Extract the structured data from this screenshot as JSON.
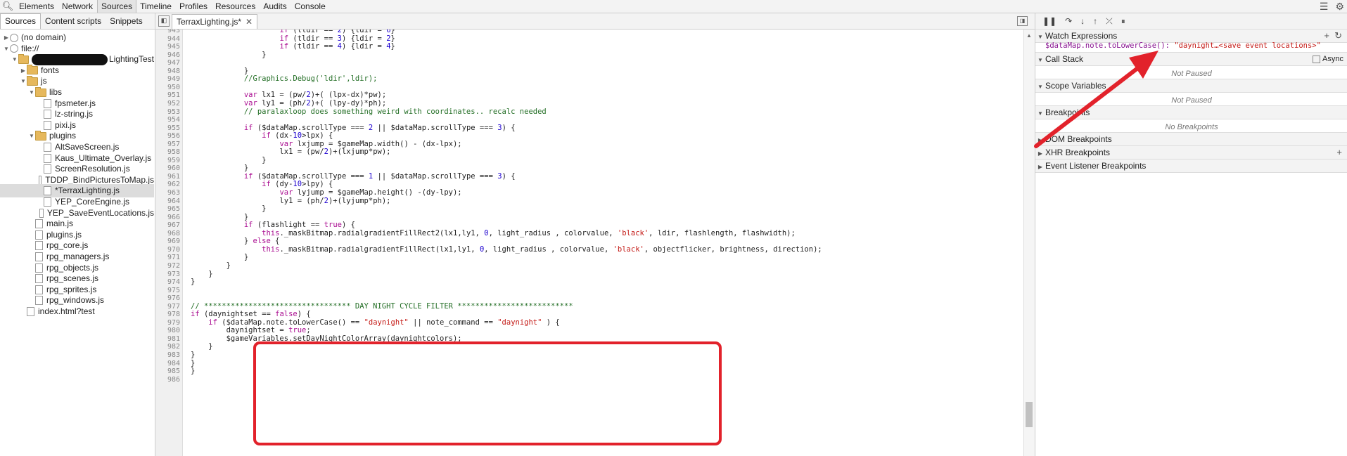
{
  "toolbar": {
    "tabs": [
      "Elements",
      "Network",
      "Sources",
      "Timeline",
      "Profiles",
      "Resources",
      "Audits",
      "Console"
    ],
    "active_tab": "Sources"
  },
  "sidebar": {
    "tabs": [
      "Sources",
      "Content scripts",
      "Snippets"
    ],
    "tree": [
      {
        "label": "(no domain)",
        "type": "globe",
        "depth": 0,
        "arrow": "▶"
      },
      {
        "label": "file://",
        "type": "globe",
        "depth": 0,
        "arrow": "▼"
      },
      {
        "label": "LightingTest",
        "type": "folder",
        "depth": 1,
        "arrow": "▼",
        "redacted": true
      },
      {
        "label": "fonts",
        "type": "folder",
        "depth": 2,
        "arrow": "▶"
      },
      {
        "label": "js",
        "type": "folder",
        "depth": 2,
        "arrow": "▼"
      },
      {
        "label": "libs",
        "type": "folder",
        "depth": 3,
        "arrow": "▼"
      },
      {
        "label": "fpsmeter.js",
        "type": "file",
        "depth": 4
      },
      {
        "label": "lz-string.js",
        "type": "file",
        "depth": 4
      },
      {
        "label": "pixi.js",
        "type": "file",
        "depth": 4
      },
      {
        "label": "plugins",
        "type": "folder",
        "depth": 3,
        "arrow": "▼"
      },
      {
        "label": "AltSaveScreen.js",
        "type": "file",
        "depth": 4
      },
      {
        "label": "Kaus_Ultimate_Overlay.js",
        "type": "file",
        "depth": 4
      },
      {
        "label": "ScreenResolution.js",
        "type": "file",
        "depth": 4
      },
      {
        "label": "TDDP_BindPicturesToMap.js",
        "type": "file",
        "depth": 4
      },
      {
        "label": "*TerraxLighting.js",
        "type": "file",
        "depth": 4,
        "selected": true
      },
      {
        "label": "YEP_CoreEngine.js",
        "type": "file",
        "depth": 4
      },
      {
        "label": "YEP_SaveEventLocations.js",
        "type": "file",
        "depth": 4
      },
      {
        "label": "main.js",
        "type": "file",
        "depth": 3
      },
      {
        "label": "plugins.js",
        "type": "file",
        "depth": 3
      },
      {
        "label": "rpg_core.js",
        "type": "file",
        "depth": 3
      },
      {
        "label": "rpg_managers.js",
        "type": "file",
        "depth": 3
      },
      {
        "label": "rpg_objects.js",
        "type": "file",
        "depth": 3
      },
      {
        "label": "rpg_scenes.js",
        "type": "file",
        "depth": 3
      },
      {
        "label": "rpg_sprites.js",
        "type": "file",
        "depth": 3
      },
      {
        "label": "rpg_windows.js",
        "type": "file",
        "depth": 3
      },
      {
        "label": "index.html?test",
        "type": "file",
        "depth": 2
      }
    ]
  },
  "editor": {
    "file_tab": "TerraxLighting.js*",
    "lines": [
      {
        "n": 943,
        "html": "                    <span class=\"kw\">if</span> (tldir == <span class=\"num\">2</span>) {ldir = <span class=\"num\">6</span>}"
      },
      {
        "n": 944,
        "html": "                    <span class=\"kw\">if</span> (tldir == <span class=\"num\">3</span>) {ldir = <span class=\"num\">2</span>}"
      },
      {
        "n": 945,
        "html": "                    <span class=\"kw\">if</span> (tldir == <span class=\"num\">4</span>) {ldir = <span class=\"num\">4</span>}"
      },
      {
        "n": 946,
        "html": "                }"
      },
      {
        "n": 947,
        "html": ""
      },
      {
        "n": 948,
        "html": "            }"
      },
      {
        "n": 949,
        "html": "            <span class=\"cm\">//Graphics.Debug('ldir',ldir);</span>"
      },
      {
        "n": 950,
        "html": ""
      },
      {
        "n": 951,
        "html": "            <span class=\"kw\">var</span> lx1 = (pw/<span class=\"num\">2</span>)+( (lpx-dx)*pw);"
      },
      {
        "n": 952,
        "html": "            <span class=\"kw\">var</span> ly1 = (ph/<span class=\"num\">2</span>)+( (lpy-dy)*ph);"
      },
      {
        "n": 953,
        "html": "            <span class=\"cm\">// paralaxloop does something weird with coordinates.. recalc needed</span>"
      },
      {
        "n": 954,
        "html": ""
      },
      {
        "n": 955,
        "html": "            <span class=\"kw\">if</span> ($dataMap.scrollType === <span class=\"num\">2</span> || $dataMap.scrollType === <span class=\"num\">3</span>) {"
      },
      {
        "n": 956,
        "html": "                <span class=\"kw\">if</span> (dx-<span class=\"num\">10</span>&gt;lpx) {"
      },
      {
        "n": 957,
        "html": "                    <span class=\"kw\">var</span> lxjump = $gameMap.width() - (dx-lpx);"
      },
      {
        "n": 958,
        "html": "                    lx1 = (pw/<span class=\"num\">2</span>)+(lxjump*pw);"
      },
      {
        "n": 959,
        "html": "                }"
      },
      {
        "n": 960,
        "html": "            }"
      },
      {
        "n": 961,
        "html": "            <span class=\"kw\">if</span> ($dataMap.scrollType === <span class=\"num\">1</span> || $dataMap.scrollType === <span class=\"num\">3</span>) {"
      },
      {
        "n": 962,
        "html": "                <span class=\"kw\">if</span> (dy-<span class=\"num\">10</span>&gt;lpy) {"
      },
      {
        "n": 963,
        "html": "                    <span class=\"kw\">var</span> lyjump = $gameMap.height() -(dy-lpy);"
      },
      {
        "n": 964,
        "html": "                    ly1 = (ph/<span class=\"num\">2</span>)+(lyjump*ph);"
      },
      {
        "n": 965,
        "html": "                }"
      },
      {
        "n": 966,
        "html": "            }"
      },
      {
        "n": 967,
        "html": "            <span class=\"kw\">if</span> (flashlight == <span class=\"kw\">true</span>) {"
      },
      {
        "n": 968,
        "html": "                <span class=\"kw\">this</span>._maskBitmap.radialgradientFillRect2(lx1,ly1, <span class=\"num\">0</span>, light_radius , colorvalue, <span class=\"str\">'black'</span>, ldir, flashlength, flashwidth);"
      },
      {
        "n": 969,
        "html": "            } <span class=\"kw\">else</span> {"
      },
      {
        "n": 970,
        "html": "                <span class=\"kw\">this</span>._maskBitmap.radialgradientFillRect(lx1,ly1, <span class=\"num\">0</span>, light_radius , colorvalue, <span class=\"str\">'black'</span>, objectflicker, brightness, direction);"
      },
      {
        "n": 971,
        "html": "            }"
      },
      {
        "n": 972,
        "html": "        }"
      },
      {
        "n": 973,
        "html": "    }"
      },
      {
        "n": 974,
        "html": "}"
      },
      {
        "n": 975,
        "html": ""
      },
      {
        "n": 976,
        "html": ""
      },
      {
        "n": 977,
        "html": "<span class=\"cm\">// ********************************* DAY NIGHT CYCLE FILTER **************************</span>"
      },
      {
        "n": 978,
        "html": "<span class=\"kw\">if</span> (daynightset == <span class=\"kw\">false</span>) {"
      },
      {
        "n": 979,
        "html": "    <span class=\"kw\">if</span> ($dataMap.note.toLowerCase() == <span class=\"str\">\"daynight\"</span> || note_command == <span class=\"str\">\"daynight\"</span> ) {"
      },
      {
        "n": 980,
        "html": "        daynightset = <span class=\"kw\">true</span>;"
      },
      {
        "n": 981,
        "html": "        $gameVariables.setDayNightColorArray(daynightcolors);"
      },
      {
        "n": 982,
        "html": "    }"
      },
      {
        "n": 983,
        "html": "}"
      },
      {
        "n": 984,
        "html": "}"
      },
      {
        "n": 985,
        "html": "}"
      },
      {
        "n": 986,
        "html": ""
      }
    ]
  },
  "debugger": {
    "watch_title": "Watch Expressions",
    "watch_expr": "$dataMap.note.toLowerCase():",
    "watch_value": "\"daynight…<save event locations>\"",
    "call_stack_title": "Call Stack",
    "async_label": "Async",
    "not_paused": "Not Paused",
    "scope_title": "Scope Variables",
    "breakpoints_title": "Breakpoints",
    "no_breakpoints": "No Breakpoints",
    "dom_bp_title": "DOM Breakpoints",
    "xhr_bp_title": "XHR Breakpoints",
    "event_bp_title": "Event Listener Breakpoints"
  }
}
